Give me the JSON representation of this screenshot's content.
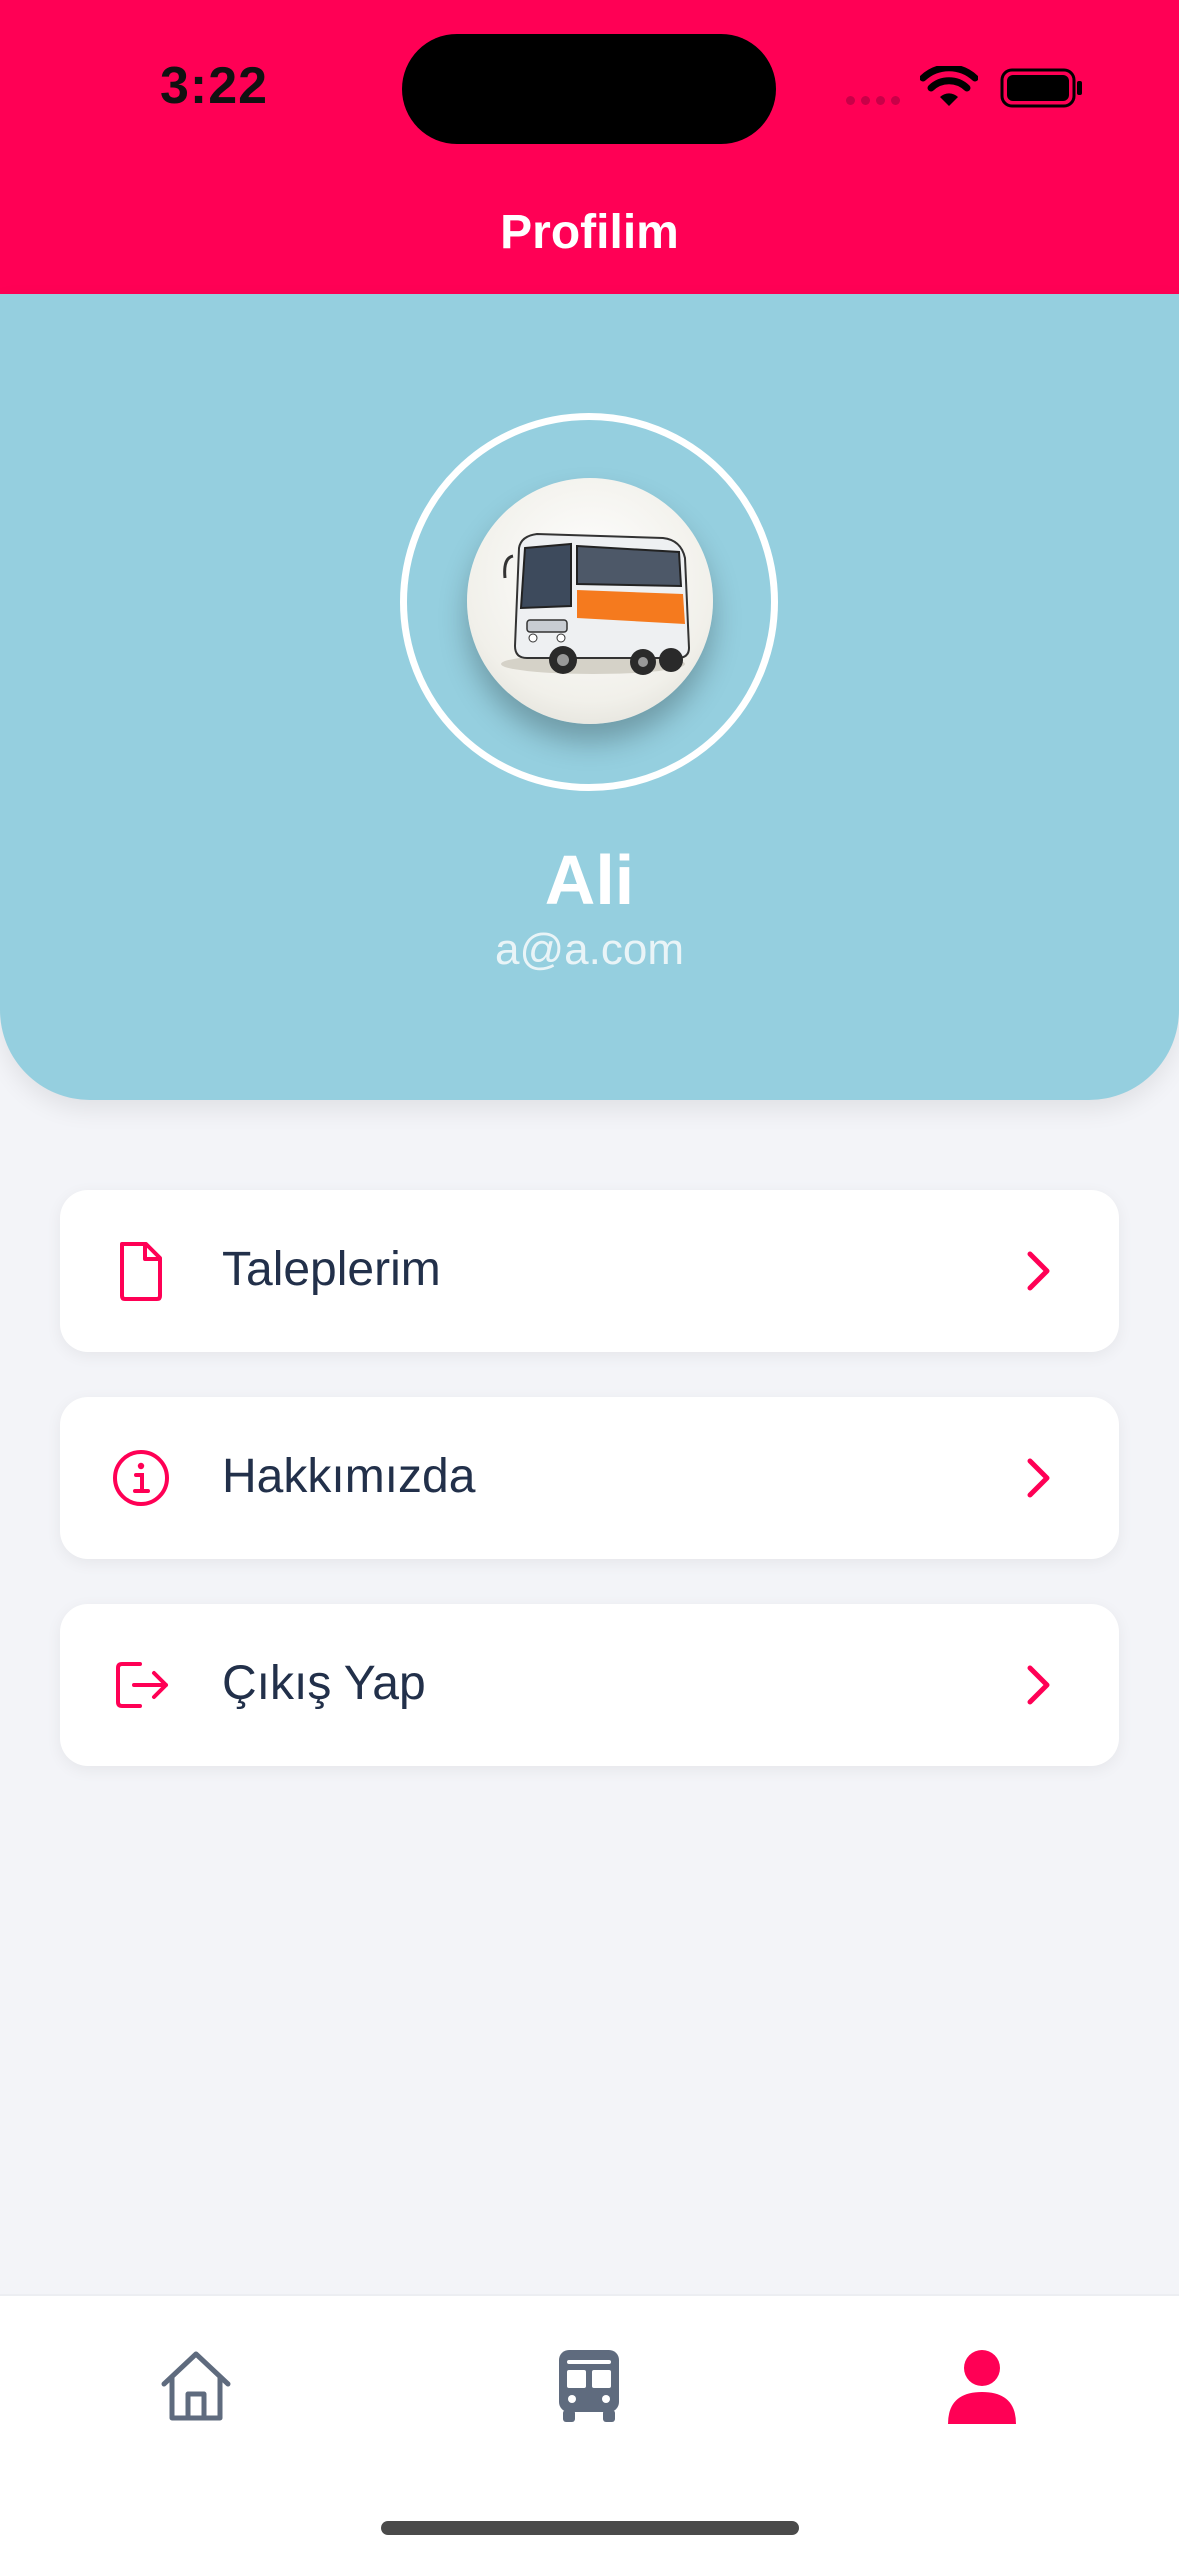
{
  "status_bar": {
    "time": "3:22"
  },
  "nav": {
    "title": "Profilim"
  },
  "profile": {
    "name": "Ali",
    "email": "a@a.com"
  },
  "menu": [
    {
      "label": "Taleplerim",
      "icon": "document-icon"
    },
    {
      "label": "Hakkımızda",
      "icon": "info-icon"
    },
    {
      "label": "Çıkış Yap",
      "icon": "logout-icon"
    }
  ],
  "tabs": [
    {
      "icon": "home-icon",
      "active": false
    },
    {
      "icon": "bus-icon",
      "active": false
    },
    {
      "icon": "user-icon",
      "active": true
    }
  ],
  "colors": {
    "accent": "#ff0055",
    "header_bg": "#95cfdf",
    "inactive_tab": "#5f6b7e",
    "text": "#22304a"
  }
}
